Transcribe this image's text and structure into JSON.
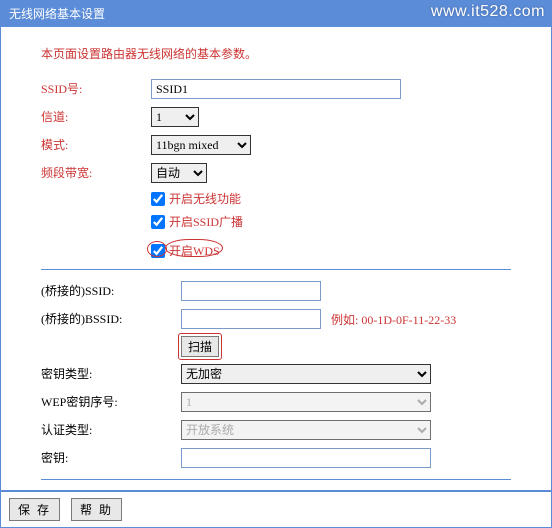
{
  "window": {
    "title": "无线网络基本设置",
    "watermark": "www.it528.com"
  },
  "intro": "本页面设置路由器无线网络的基本参数。",
  "fields": {
    "ssid": {
      "label": "SSID号:",
      "value": "SSID1"
    },
    "channel": {
      "label": "信道:",
      "value": "1"
    },
    "mode": {
      "label": "模式:",
      "value": "11bgn mixed"
    },
    "bandwidth": {
      "label": "频段带宽:",
      "value": "自动"
    }
  },
  "checkboxes": {
    "enable_wireless": {
      "label": "开启无线功能",
      "checked": true
    },
    "enable_ssid_broadcast": {
      "label": "开启SSID广播",
      "checked": true
    },
    "enable_wds": {
      "label": "开启WDS",
      "checked": true
    }
  },
  "bridge": {
    "ssid": {
      "label": "(桥接的)SSID:",
      "value": ""
    },
    "bssid": {
      "label": "(桥接的)BSSID:",
      "value": "",
      "example_prefix": "例如:",
      "example_value": "00-1D-0F-11-22-33"
    },
    "scan": "扫描",
    "key_type": {
      "label": "密钥类型:",
      "value": "无加密"
    },
    "wep_index": {
      "label": "WEP密钥序号:",
      "value": "1"
    },
    "auth_type": {
      "label": "认证类型:",
      "value": "开放系统"
    },
    "key": {
      "label": "密钥:",
      "value": ""
    }
  },
  "footer": {
    "save": "保 存",
    "help": "帮 助"
  }
}
